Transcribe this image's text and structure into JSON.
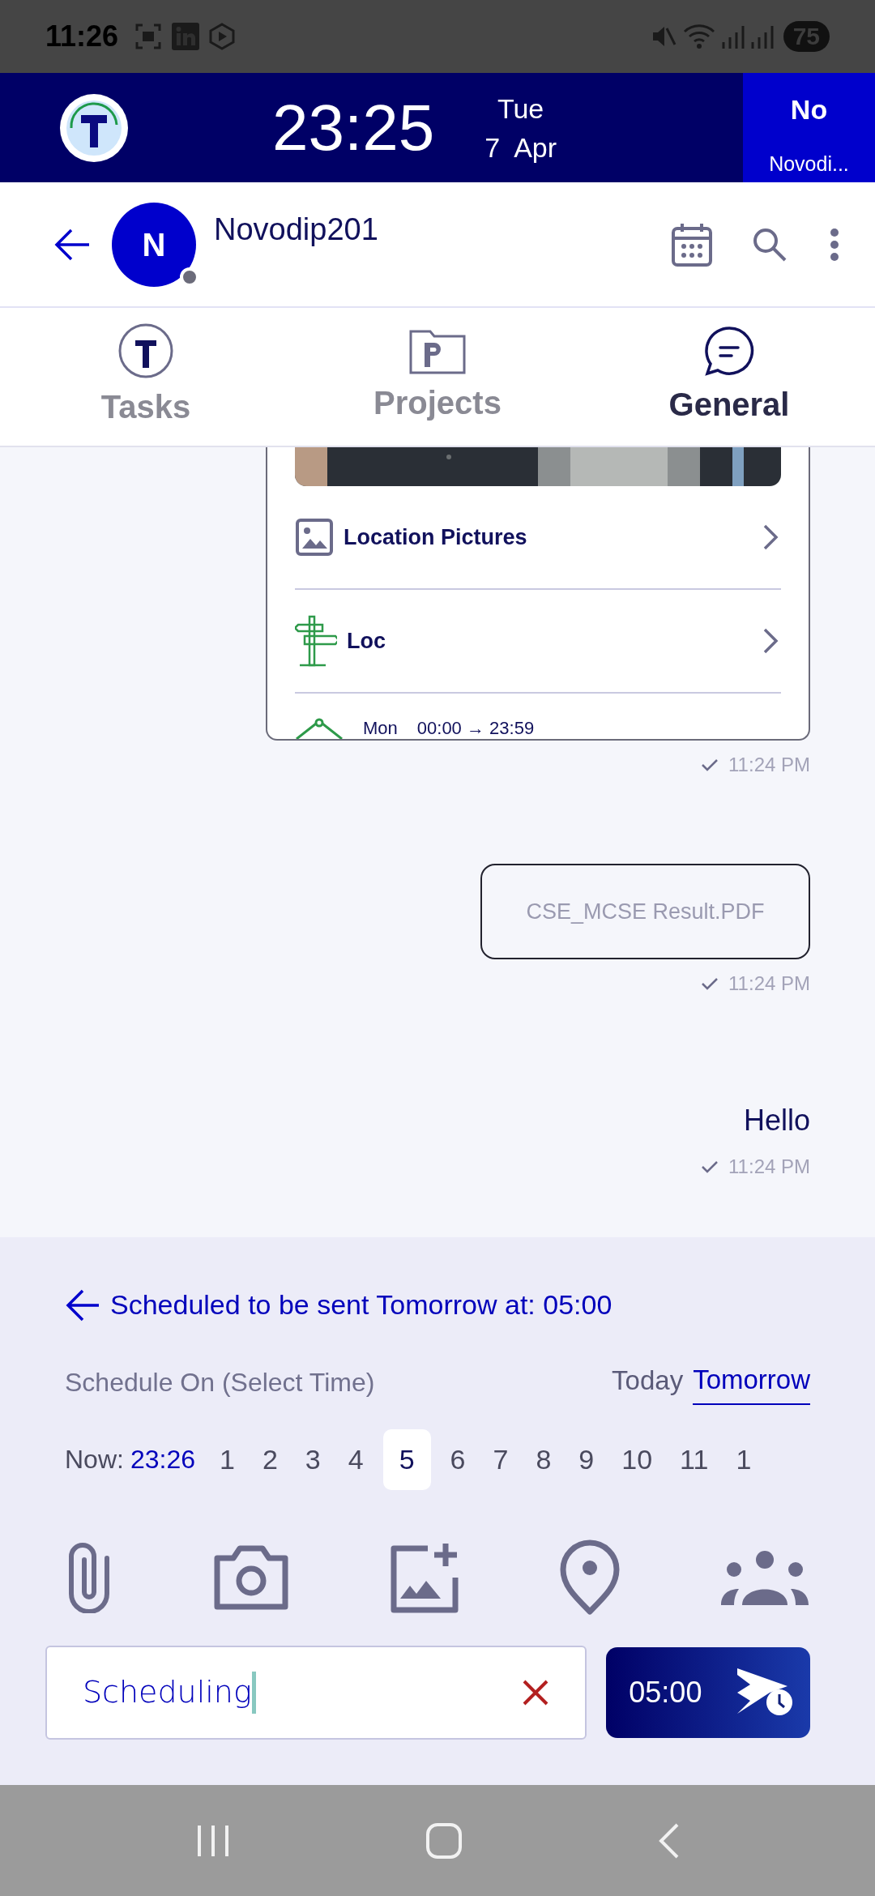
{
  "status_bar": {
    "time": "11:26",
    "battery": "75"
  },
  "app_bar": {
    "clock": "23:25",
    "day": "Tue",
    "date": "7  Apr",
    "user_short": "No",
    "user_name": "Novodi..."
  },
  "header": {
    "avatar_letter": "N",
    "name": "Novodip201"
  },
  "tabs": [
    {
      "label": "Tasks",
      "selected": false
    },
    {
      "label": "Projects",
      "selected": false
    },
    {
      "label": "General",
      "selected": true
    }
  ],
  "messages": [
    {
      "kind": "card",
      "rows": [
        {
          "kind": "pictures",
          "label": "Location Pictures"
        },
        {
          "kind": "place",
          "label": "Loc"
        },
        {
          "kind": "hours",
          "day": "Mon",
          "range": "00:00 → 23:59"
        }
      ],
      "time": "11:24 PM"
    },
    {
      "kind": "file",
      "name": "CSE_MCSE Result.PDF",
      "time": "11:24 PM"
    },
    {
      "kind": "text",
      "text": "Hello",
      "time": "11:24 PM"
    }
  ],
  "schedule": {
    "summary": "Scheduled to be sent Tomorrow at: 05:00",
    "label": "Schedule On (Select Time)",
    "days": [
      {
        "label": "Today",
        "selected": false
      },
      {
        "label": "Tomorrow",
        "selected": true
      }
    ],
    "now_label": "Now:",
    "now_time": "23:26",
    "hours": [
      {
        "label": "1",
        "selected": false
      },
      {
        "label": "2",
        "selected": false
      },
      {
        "label": "3",
        "selected": false
      },
      {
        "label": "4",
        "selected": false
      },
      {
        "label": "5",
        "selected": true
      },
      {
        "label": "6",
        "selected": false
      },
      {
        "label": "7",
        "selected": false
      },
      {
        "label": "8",
        "selected": false
      },
      {
        "label": "9",
        "selected": false
      },
      {
        "label": "10",
        "selected": false
      },
      {
        "label": "11",
        "selected": false
      },
      {
        "label": "1",
        "selected": false
      }
    ]
  },
  "composer": {
    "value": "Scheduling",
    "send_time": "05:00"
  }
}
